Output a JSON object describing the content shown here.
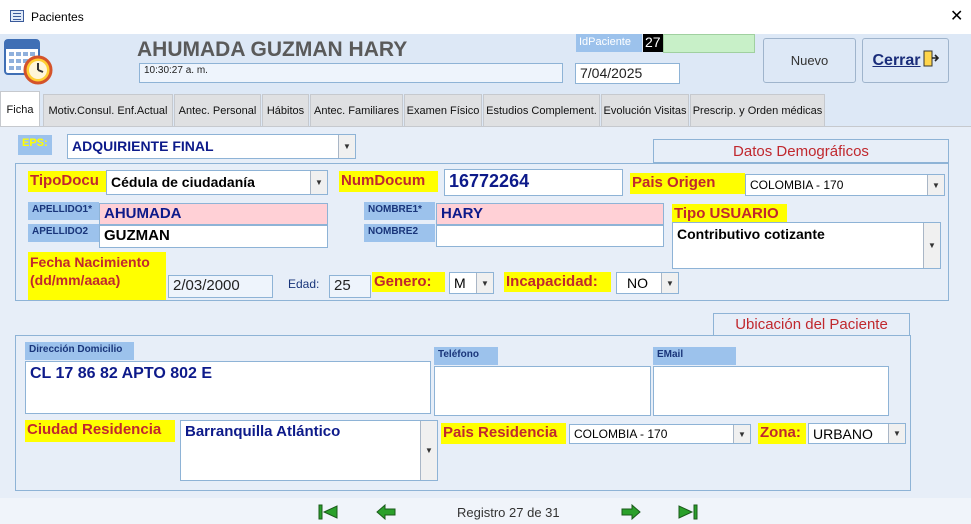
{
  "window": {
    "title": "Pacientes",
    "close_symbol": "✕"
  },
  "header": {
    "patient_name": "AHUMADA GUZMAN HARY",
    "time": "10:30:27 a. m.",
    "id_label": "IdPaciente",
    "id_value": "27",
    "date": "7/04/2025",
    "new_button": "Nuevo",
    "close_button": "Cerrar"
  },
  "tabs": [
    {
      "label": "Ficha",
      "active": true
    },
    {
      "label": "Motiv.Consul. Enf.Actual"
    },
    {
      "label": "Antec. Personal"
    },
    {
      "label": "Hábitos"
    },
    {
      "label": "Antec. Familiares"
    },
    {
      "label": "Examen Físico"
    },
    {
      "label": "Estudios Complement."
    },
    {
      "label": "Evolución Visitas"
    },
    {
      "label": "Prescrip. y Orden médicas"
    }
  ],
  "form": {
    "eps_label": "EPS:",
    "eps_value": "ADQUIRIENTE  FINAL",
    "section_demographics": "Datos Demográficos",
    "tipodoc_label": "TipoDocu",
    "tipodoc_value": "Cédula de ciudadanía",
    "numdoc_label": "NumDocum",
    "numdoc_value": "16772264",
    "pais_origen_label": "Pais Origen",
    "pais_origen_value": "COLOMBIA - 170",
    "apellido1_label": "APELLIDO1*",
    "apellido1_value": "AHUMADA",
    "apellido2_label": "APELLIDO2",
    "apellido2_value": "GUZMAN",
    "nombre1_label": "NOMBRE1*",
    "nombre1_value": "HARY",
    "nombre2_label": "NOMBRE2",
    "nombre2_value": "",
    "tipo_usuario_label": "Tipo USUARIO",
    "tipo_usuario_value": "Contributivo cotizante",
    "fecha_nac_label_1": "Fecha Nacimiento",
    "fecha_nac_label_2": "(dd/mm/aaaa)",
    "fecha_nac_value": "2/03/2000",
    "edad_label": "Edad:",
    "edad_value": "25",
    "genero_label": "Genero:",
    "genero_value": "M",
    "incapacidad_label": "Incapacidad:",
    "incapacidad_value": "NO",
    "section_location": "Ubicación del Paciente",
    "direccion_label": "Dirección Domicilio",
    "direccion_value": "CL 17 86 82 APTO 802 E",
    "telefono_label": "Teléfono",
    "telefono_value": "",
    "email_label": "EMail",
    "email_value": "",
    "ciudad_label": "Ciudad Residencia",
    "ciudad_value": "Barranquilla  Atlántico",
    "pais_res_label": "Pais Residencia",
    "pais_res_value": "COLOMBIA - 170",
    "zona_label": "Zona:",
    "zona_value": "URBANO"
  },
  "footer": {
    "record_text": "Registro 27 de 31"
  },
  "colors": {
    "accent_green": "#2aa02a",
    "label_yellow": "#ffff00",
    "label_red": "#c0282e",
    "label_blue": "#9cc2ec"
  }
}
